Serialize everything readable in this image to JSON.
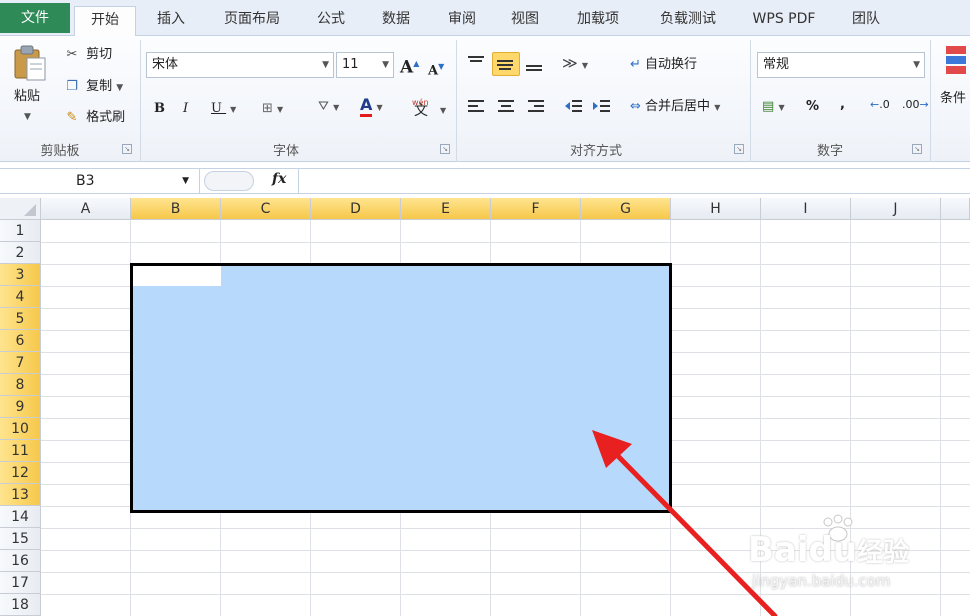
{
  "menu": {
    "tabs": [
      "文件",
      "开始",
      "插入",
      "页面布局",
      "公式",
      "数据",
      "审阅",
      "视图",
      "加载项",
      "负载测试",
      "WPS PDF",
      "团队"
    ],
    "active": "开始"
  },
  "ribbon": {
    "clipboard": {
      "paste": "粘贴",
      "cut": "剪切",
      "copy": "复制",
      "format_painter": "格式刷",
      "group": "剪贴板"
    },
    "font": {
      "name": "宋体",
      "size": "11",
      "bold": "B",
      "italic": "I",
      "underline": "U",
      "grow": "A",
      "shrink": "A",
      "font_color_glyph": "A",
      "phonetic": "wén",
      "phonetic_glyph": "文",
      "group": "字体"
    },
    "alignment": {
      "wrap": "自动换行",
      "merge": "合并后居中",
      "group": "对齐方式"
    },
    "number": {
      "format": "常规",
      "percent": "%",
      "comma": ",",
      "inc_decimal": ".0",
      "dec_decimal": ".00",
      "group": "数字"
    },
    "styles": {
      "conditional": "条件"
    }
  },
  "formula_bar": {
    "name_box": "B3",
    "fx": "fx",
    "value": ""
  },
  "grid": {
    "columns": [
      "A",
      "B",
      "C",
      "D",
      "E",
      "F",
      "G",
      "H",
      "I",
      "J"
    ],
    "selected_columns": [
      "B",
      "C",
      "D",
      "E",
      "F",
      "G"
    ],
    "rows": [
      "1",
      "2",
      "3",
      "4",
      "5",
      "6",
      "7",
      "8",
      "9",
      "10",
      "11",
      "12",
      "13",
      "14",
      "15",
      "16",
      "17",
      "18"
    ],
    "selected_rows": [
      "3",
      "4",
      "5",
      "6",
      "7",
      "8",
      "9",
      "10",
      "11",
      "12",
      "13"
    ],
    "selection_range": "B3:G13",
    "selection_color": "#b7d9fb"
  },
  "annotation": {
    "arrow_color": "#e8201f"
  },
  "watermark": {
    "logo": "Bai",
    "logo2": "du",
    "brand": "经验",
    "site": "jingyan.baidu.com"
  }
}
